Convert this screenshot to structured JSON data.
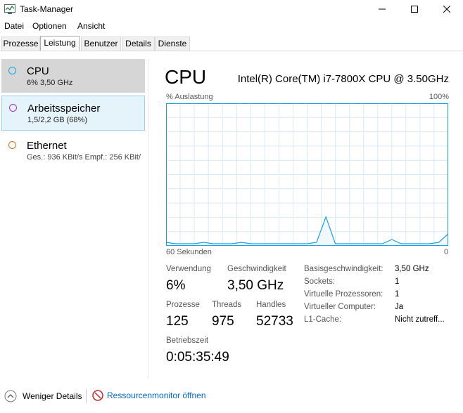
{
  "window": {
    "title": "Task-Manager"
  },
  "menu": [
    "Datei",
    "Optionen",
    "Ansicht"
  ],
  "tabs": [
    "Prozesse",
    "Leistung",
    "Benutzer",
    "Details",
    "Dienste"
  ],
  "sidebar": {
    "items": [
      {
        "name": "CPU",
        "sub": "6% 3,50 GHz",
        "color": "#1ba1e2"
      },
      {
        "name": "Arbeitsspeicher",
        "sub": "1,5/2,2 GB (68%)",
        "color": "#a333c8"
      },
      {
        "name": "Ethernet",
        "sub": "Ges.: 936 KBit/s Empf.: 256 KBit/",
        "color": "#d46f16"
      }
    ]
  },
  "main": {
    "title": "CPU",
    "model": "Intel(R) Core(TM) i7-7800X CPU @ 3.50GHz",
    "graph_label_left": "% Auslastung",
    "graph_label_right": "100%",
    "axis_left": "60 Sekunden",
    "axis_right": "0"
  },
  "stats": {
    "usage_label": "Verwendung",
    "usage": "6%",
    "speed_label": "Geschwindigkeit",
    "speed": "3,50 GHz",
    "processes_label": "Prozesse",
    "processes": "125",
    "threads_label": "Threads",
    "threads": "975",
    "handles_label": "Handles",
    "handles": "52733",
    "uptime_label": "Betriebszeit",
    "uptime": "0:05:35:49"
  },
  "info": [
    {
      "label": "Basisgeschwindigkeit:",
      "value": "3,50 GHz"
    },
    {
      "label": "Sockets:",
      "value": "1"
    },
    {
      "label": "Virtuelle Prozessoren:",
      "value": "1"
    },
    {
      "label": "Virtueller Computer:",
      "value": "Ja"
    },
    {
      "label": "L1-Cache:",
      "value": "Nicht zutreff..."
    }
  ],
  "footer": {
    "less_details": "Weniger Details",
    "resource_monitor": "Ressourcenmonitor öffnen"
  },
  "colors": {
    "graph_line": "#1ba1e2",
    "graph_border": "#1ba1e2",
    "graph_grid": "#d9eaf7",
    "link": "#0066cc"
  },
  "chart_data": {
    "type": "line",
    "x": [
      60,
      58,
      56,
      54,
      52,
      50,
      48,
      46,
      44,
      42,
      40,
      38,
      36,
      34,
      32,
      30,
      28,
      26,
      24,
      22,
      20,
      18,
      16,
      14,
      12,
      10,
      8,
      6,
      4,
      2,
      0
    ],
    "values": [
      2,
      1,
      1,
      1,
      2,
      1,
      1,
      1,
      2,
      1,
      1,
      1,
      1,
      1,
      1,
      1,
      2,
      20,
      1,
      1,
      1,
      1,
      1,
      1,
      4,
      1,
      1,
      1,
      1,
      2,
      8
    ],
    "xlabel": "60 Sekunden",
    "ylabel": "% Auslastung",
    "ylim": [
      0,
      100
    ]
  }
}
